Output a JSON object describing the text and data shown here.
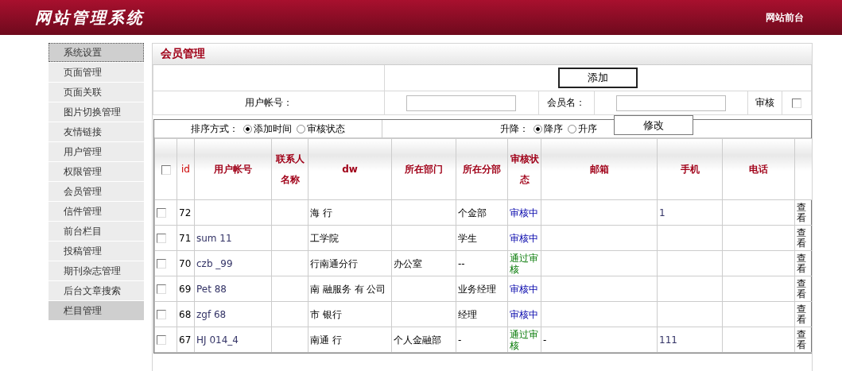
{
  "header": {
    "title": "网站管理系统",
    "link": "网站前台"
  },
  "sidebar": {
    "items": [
      {
        "label": "系统设置",
        "highlighted": true
      },
      {
        "label": "页面管理",
        "highlighted": false
      },
      {
        "label": "页面关联",
        "highlighted": false
      },
      {
        "label": "图片切换管理",
        "highlighted": false
      },
      {
        "label": "友情链接",
        "highlighted": false
      },
      {
        "label": "用户管理",
        "highlighted": false
      },
      {
        "label": "权限管理",
        "highlighted": false
      },
      {
        "label": "会员管理",
        "highlighted": false
      },
      {
        "label": "信件管理",
        "highlighted": false
      },
      {
        "label": "前台栏目",
        "highlighted": false
      },
      {
        "label": "投稿管理",
        "highlighted": false
      },
      {
        "label": "期刊杂志管理",
        "highlighted": false
      },
      {
        "label": "后台文章搜索",
        "highlighted": false
      },
      {
        "label": "栏目管理",
        "highlighted": true
      }
    ]
  },
  "panel": {
    "title": "会员管理",
    "add_button": "添加",
    "account_label": "用户帐号：",
    "member_label": "会员名：",
    "audit_label": "审核",
    "audit_checked": false,
    "edit_button": "修改",
    "sort_label": "排序方式：",
    "sort_options": [
      {
        "label": "添加时间",
        "selected": true
      },
      {
        "label": "审核状态",
        "selected": false
      }
    ],
    "order_label": "升降：",
    "order_options": [
      {
        "label": "降序",
        "selected": true
      },
      {
        "label": "升序",
        "selected": false
      }
    ]
  },
  "table": {
    "select_all_checked": false,
    "columns": [
      "id",
      "用户帐号",
      "联系人名称",
      "dw",
      "所在部门",
      "所在分部",
      "审核状态",
      "邮箱",
      "手机",
      "电话"
    ],
    "rows": [
      {
        "checked": false,
        "id": "72",
        "account": "",
        "contact": "",
        "dw": "海 行",
        "dept": "",
        "branch": "个金部",
        "status": {
          "kind": "pending",
          "label": "审核中"
        },
        "email": "",
        "mobile": "1",
        "phone": "",
        "action": "查看"
      },
      {
        "checked": false,
        "id": "71",
        "account": "sum 11",
        "contact": "",
        "dw": "工学院",
        "dept": "",
        "branch": "学生",
        "status": {
          "kind": "pending",
          "label": "审核中"
        },
        "email": "",
        "mobile": "",
        "phone": "",
        "action": "查看"
      },
      {
        "checked": false,
        "id": "70",
        "account": "czb _99",
        "contact": "",
        "dw": "行南通分行",
        "dept": "办公室",
        "branch": "--",
        "status": {
          "kind": "approved",
          "label": "通过审核"
        },
        "email": "",
        "mobile": "",
        "phone": "",
        "action": "查看"
      },
      {
        "checked": false,
        "id": "69",
        "account": "Pet 88",
        "contact": "",
        "dw": "南 融服务 有 公司",
        "dept": "",
        "branch": "业务经理",
        "status": {
          "kind": "pending",
          "label": "审核中"
        },
        "email": "",
        "mobile": "",
        "phone": "",
        "action": "查看"
      },
      {
        "checked": false,
        "id": "68",
        "account": "zgf 68",
        "contact": "",
        "dw": "市 银行",
        "dept": "",
        "branch": "经理",
        "status": {
          "kind": "pending",
          "label": "审核中"
        },
        "email": "",
        "mobile": "",
        "phone": "",
        "action": "查看"
      },
      {
        "checked": false,
        "id": "67",
        "account": "HJ 014_4",
        "contact": "",
        "dw": "南通 行",
        "dept": "个人金融部",
        "branch": "-",
        "status": {
          "kind": "approved",
          "label": "通过审核"
        },
        "email": "-",
        "mobile": "111",
        "phone": "",
        "action": "查看"
      }
    ]
  }
}
